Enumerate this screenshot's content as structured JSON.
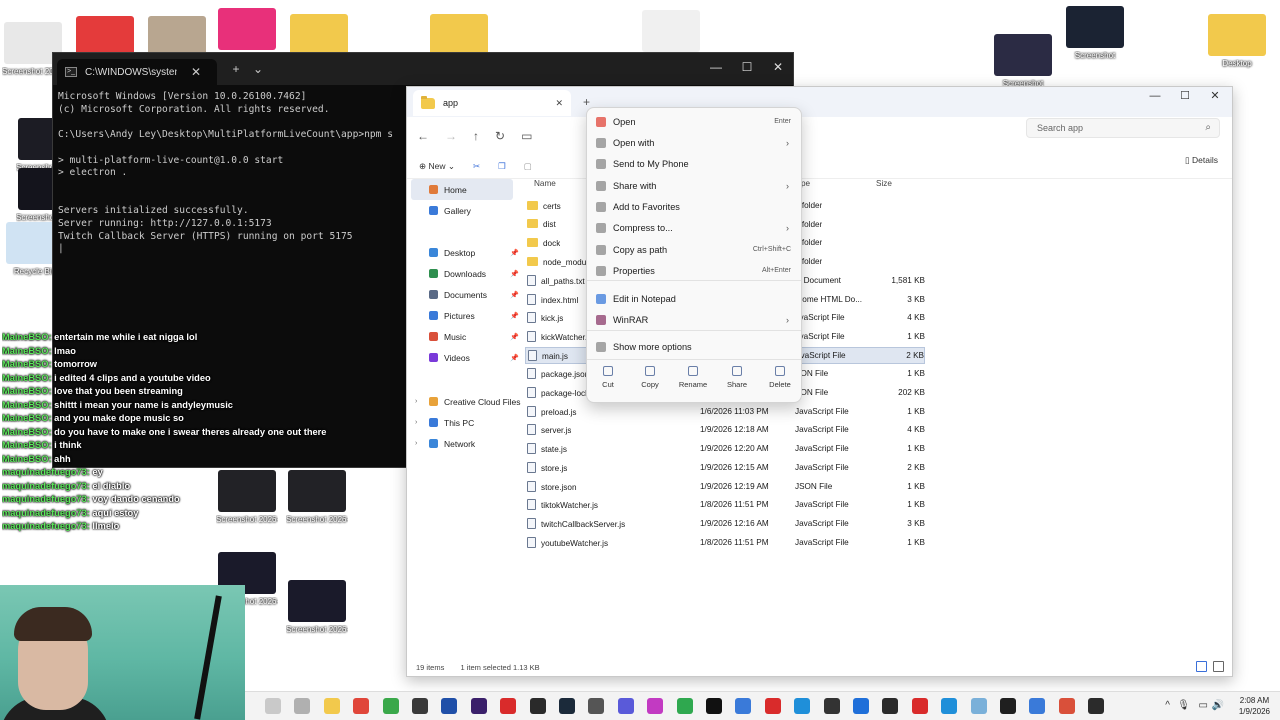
{
  "desktop": {
    "icons": [
      {
        "label": "Screenshot 2026-01...",
        "color": "#e8e8e8"
      },
      {
        "label": "",
        "color": "#e43b3b"
      },
      {
        "label": "",
        "color": "#b8a690"
      },
      {
        "label": "",
        "color": "#e8307a"
      },
      {
        "label": "",
        "color": "#f2c94c"
      },
      {
        "label": "",
        "color": "#f2c94c"
      },
      {
        "label": "",
        "color": "#f0f0f0"
      },
      {
        "label": "Screenshot",
        "color": "#2b2b44"
      },
      {
        "label": "Screenshot",
        "color": "#1b2333"
      },
      {
        "label": "Desktop",
        "color": "#f2c94c"
      },
      {
        "label": "Screenshot 2026-01...",
        "color": "#1c1c24"
      },
      {
        "label": "Screenshot 2026-01...",
        "color": "#14141c"
      },
      {
        "label": "Recycle Bin",
        "color": "#d0e3f3"
      },
      {
        "label": "Screenshot 2026-01...",
        "color": "#222226"
      },
      {
        "label": "Screenshot 2026-01...",
        "color": "#222226"
      },
      {
        "label": "Screenshot 2026-01...",
        "color": "#1a1a2a"
      },
      {
        "label": "Screenshot 2026-01...",
        "color": "#1a1a2a"
      }
    ]
  },
  "terminal": {
    "tab_title": "C:\\WINDOWS\\system32\\cmd.",
    "lines": [
      "Microsoft Windows [Version 10.0.26100.7462]",
      "(c) Microsoft Corporation. All rights reserved.",
      "",
      "C:\\Users\\Andy Ley\\Desktop\\MultiPlatformLiveCount\\app>npm s",
      "",
      "> multi-platform-live-count@1.0.0 start",
      "> electron .",
      "",
      "",
      "Servers initialized successfully.",
      "Server running: http://127.0.0.1:5173",
      "Twitch Callback Server (HTTPS) running on port 5175",
      "|"
    ]
  },
  "explorer": {
    "tab_title": "app",
    "search_placeholder": "Search app",
    "cmd": {
      "new": "New",
      "details": "Details"
    },
    "nav": [
      {
        "label": "Home",
        "color": "#e07a3a",
        "pinned": false,
        "selected": true
      },
      {
        "label": "Gallery",
        "color": "#3a7ad9",
        "pinned": false
      },
      {
        "label": "Desktop",
        "color": "#3a86d9",
        "pinned": true
      },
      {
        "label": "Downloads",
        "color": "#2f8f4f",
        "pinned": true
      },
      {
        "label": "Documents",
        "color": "#5a6a86",
        "pinned": true
      },
      {
        "label": "Pictures",
        "color": "#3a7ad9",
        "pinned": true
      },
      {
        "label": "Music",
        "color": "#d9503a",
        "pinned": true
      },
      {
        "label": "Videos",
        "color": "#7a3ad9",
        "pinned": true
      },
      {
        "label": "Creative Cloud Files",
        "color": "#e8a23a",
        "expandable": true
      },
      {
        "label": "This PC",
        "color": "#3a7ad9",
        "expandable": true
      },
      {
        "label": "Network",
        "color": "#3a86d9",
        "expandable": true
      }
    ],
    "columns": {
      "name": "Name",
      "date": "",
      "type": "pe",
      "size": "Size"
    },
    "files": [
      {
        "name": "certs",
        "date": "",
        "type": "e folder",
        "size": "",
        "dir": true
      },
      {
        "name": "dist",
        "date": "",
        "type": "e folder",
        "size": "",
        "dir": true
      },
      {
        "name": "dock",
        "date": "",
        "type": "e folder",
        "size": "",
        "dir": true
      },
      {
        "name": "node_modul",
        "date": "",
        "type": "e folder",
        "size": "",
        "dir": true
      },
      {
        "name": "all_paths.txt",
        "date": "",
        "type": "xt Document",
        "size": "1,581 KB"
      },
      {
        "name": "index.html",
        "date": "",
        "type": "hrome HTML Do...",
        "size": "3 KB"
      },
      {
        "name": "kick.js",
        "date": "",
        "type": "avaScript File",
        "size": "4 KB"
      },
      {
        "name": "kickWatcher.",
        "date": "",
        "type": "avaScript File",
        "size": "1 KB"
      },
      {
        "name": "main.js",
        "date": "",
        "type": "avaScript File",
        "size": "2 KB",
        "selected": true
      },
      {
        "name": "package.json",
        "date": "",
        "type": "SON File",
        "size": "1 KB"
      },
      {
        "name": "package-lock",
        "date": "",
        "type": "SON File",
        "size": "202 KB"
      },
      {
        "name": "preload.js",
        "date": "1/6/2026 11:03 PM",
        "type": "JavaScript File",
        "size": "1 KB"
      },
      {
        "name": "server.js",
        "date": "1/9/2026 12:18 AM",
        "type": "JavaScript File",
        "size": "4 KB"
      },
      {
        "name": "state.js",
        "date": "1/9/2026 12:20 AM",
        "type": "JavaScript File",
        "size": "1 KB"
      },
      {
        "name": "store.js",
        "date": "1/9/2026 12:15 AM",
        "type": "JavaScript File",
        "size": "2 KB"
      },
      {
        "name": "store.json",
        "date": "1/9/2026 12:19 AM",
        "type": "JSON File",
        "size": "1 KB"
      },
      {
        "name": "tiktokWatcher.js",
        "date": "1/8/2026 11:51 PM",
        "type": "JavaScript File",
        "size": "1 KB"
      },
      {
        "name": "twitchCallbackServer.js",
        "date": "1/9/2026 12:16 AM",
        "type": "JavaScript File",
        "size": "3 KB"
      },
      {
        "name": "youtubeWatcher.js",
        "date": "1/8/2026 11:51 PM",
        "type": "JavaScript File",
        "size": "1 KB"
      }
    ],
    "status": {
      "count": "19 items",
      "selected": "1 item selected  1.13 KB"
    }
  },
  "context_menu": {
    "items": [
      {
        "label": "Open",
        "key": "Enter",
        "icon": "#e0463a"
      },
      {
        "label": "Open with",
        "arrow": true,
        "icon": "#888888"
      },
      {
        "label": "Send to My Phone",
        "icon": "#888888"
      },
      {
        "label": "Share with",
        "arrow": true,
        "icon": "#888888"
      },
      {
        "label": "Add to Favorites",
        "icon": "#888888"
      },
      {
        "label": "Compress to...",
        "arrow": true,
        "icon": "#888888"
      },
      {
        "label": "Copy as path",
        "key": "Ctrl+Shift+C",
        "icon": "#888888"
      },
      {
        "label": "Properties",
        "key": "Alt+Enter",
        "icon": "#888888"
      },
      {
        "label": "Edit in Notepad",
        "icon": "#3a7ad9"
      },
      {
        "label": "WinRAR",
        "arrow": true,
        "icon": "#8a3a6a"
      },
      {
        "label": "Show more options",
        "icon": "#888888"
      }
    ],
    "actions": [
      "Cut",
      "Copy",
      "Rename",
      "Share",
      "Delete"
    ]
  },
  "chat": [
    {
      "user": "MaineBSO:",
      "msg": " entertain me while i eat nigga lol"
    },
    {
      "user": "MaineBSO:",
      "msg": " lmao"
    },
    {
      "user": "MaineBSO:",
      "msg": " tomorrow"
    },
    {
      "user": "MaineBSO:",
      "msg": " i edited 4 clips and a youtube video"
    },
    {
      "user": "MaineBSO:",
      "msg": " love that you been streaming"
    },
    {
      "user": "MaineBSO:",
      "msg": " shittt i mean your name is andyleymusic"
    },
    {
      "user": "MaineBSO:",
      "msg": " and you make dope music so"
    },
    {
      "user": "MaineBSO:",
      "msg": " do you have to make one i swear theres already one out there"
    },
    {
      "user": "MaineBSO:",
      "msg": " i think"
    },
    {
      "user": "MaineBSO:",
      "msg": " ahh"
    },
    {
      "user": "maquinadefuego73:",
      "msg": " ey"
    },
    {
      "user": "maquinadefuego73:",
      "msg": " el diablo"
    },
    {
      "user": "maquinadefuego73:",
      "msg": " voy dando cenando"
    },
    {
      "user": "maquinadefuego73:",
      "msg": " aquí estoy"
    },
    {
      "user": "maquinadefuego73:",
      "msg": " llmelo"
    }
  ],
  "taskbar": {
    "icons": [
      "#c9c9c9",
      "#b0b0b0",
      "#f2c94c",
      "#e0463a",
      "#3aa84a",
      "#3a3a3a",
      "#1f4fa8",
      "#3a1f6a",
      "#d92b2b",
      "#2a2a2a",
      "#1b2a3a",
      "#555555",
      "#5a5ad9",
      "#c23ac2",
      "#2fa84f",
      "#111111",
      "#3a7ad9",
      "#d92b2b",
      "#1f8fd9",
      "#333333",
      "#1f6fd9",
      "#2b2b2b",
      "#d92b2b",
      "#1f8fd9",
      "#7ab0d9",
      "#1f1f1f",
      "#3a7ad9",
      "#d9503a",
      "#2b2b2b"
    ],
    "time": "2:08 AM",
    "date": "1/9/2026"
  }
}
